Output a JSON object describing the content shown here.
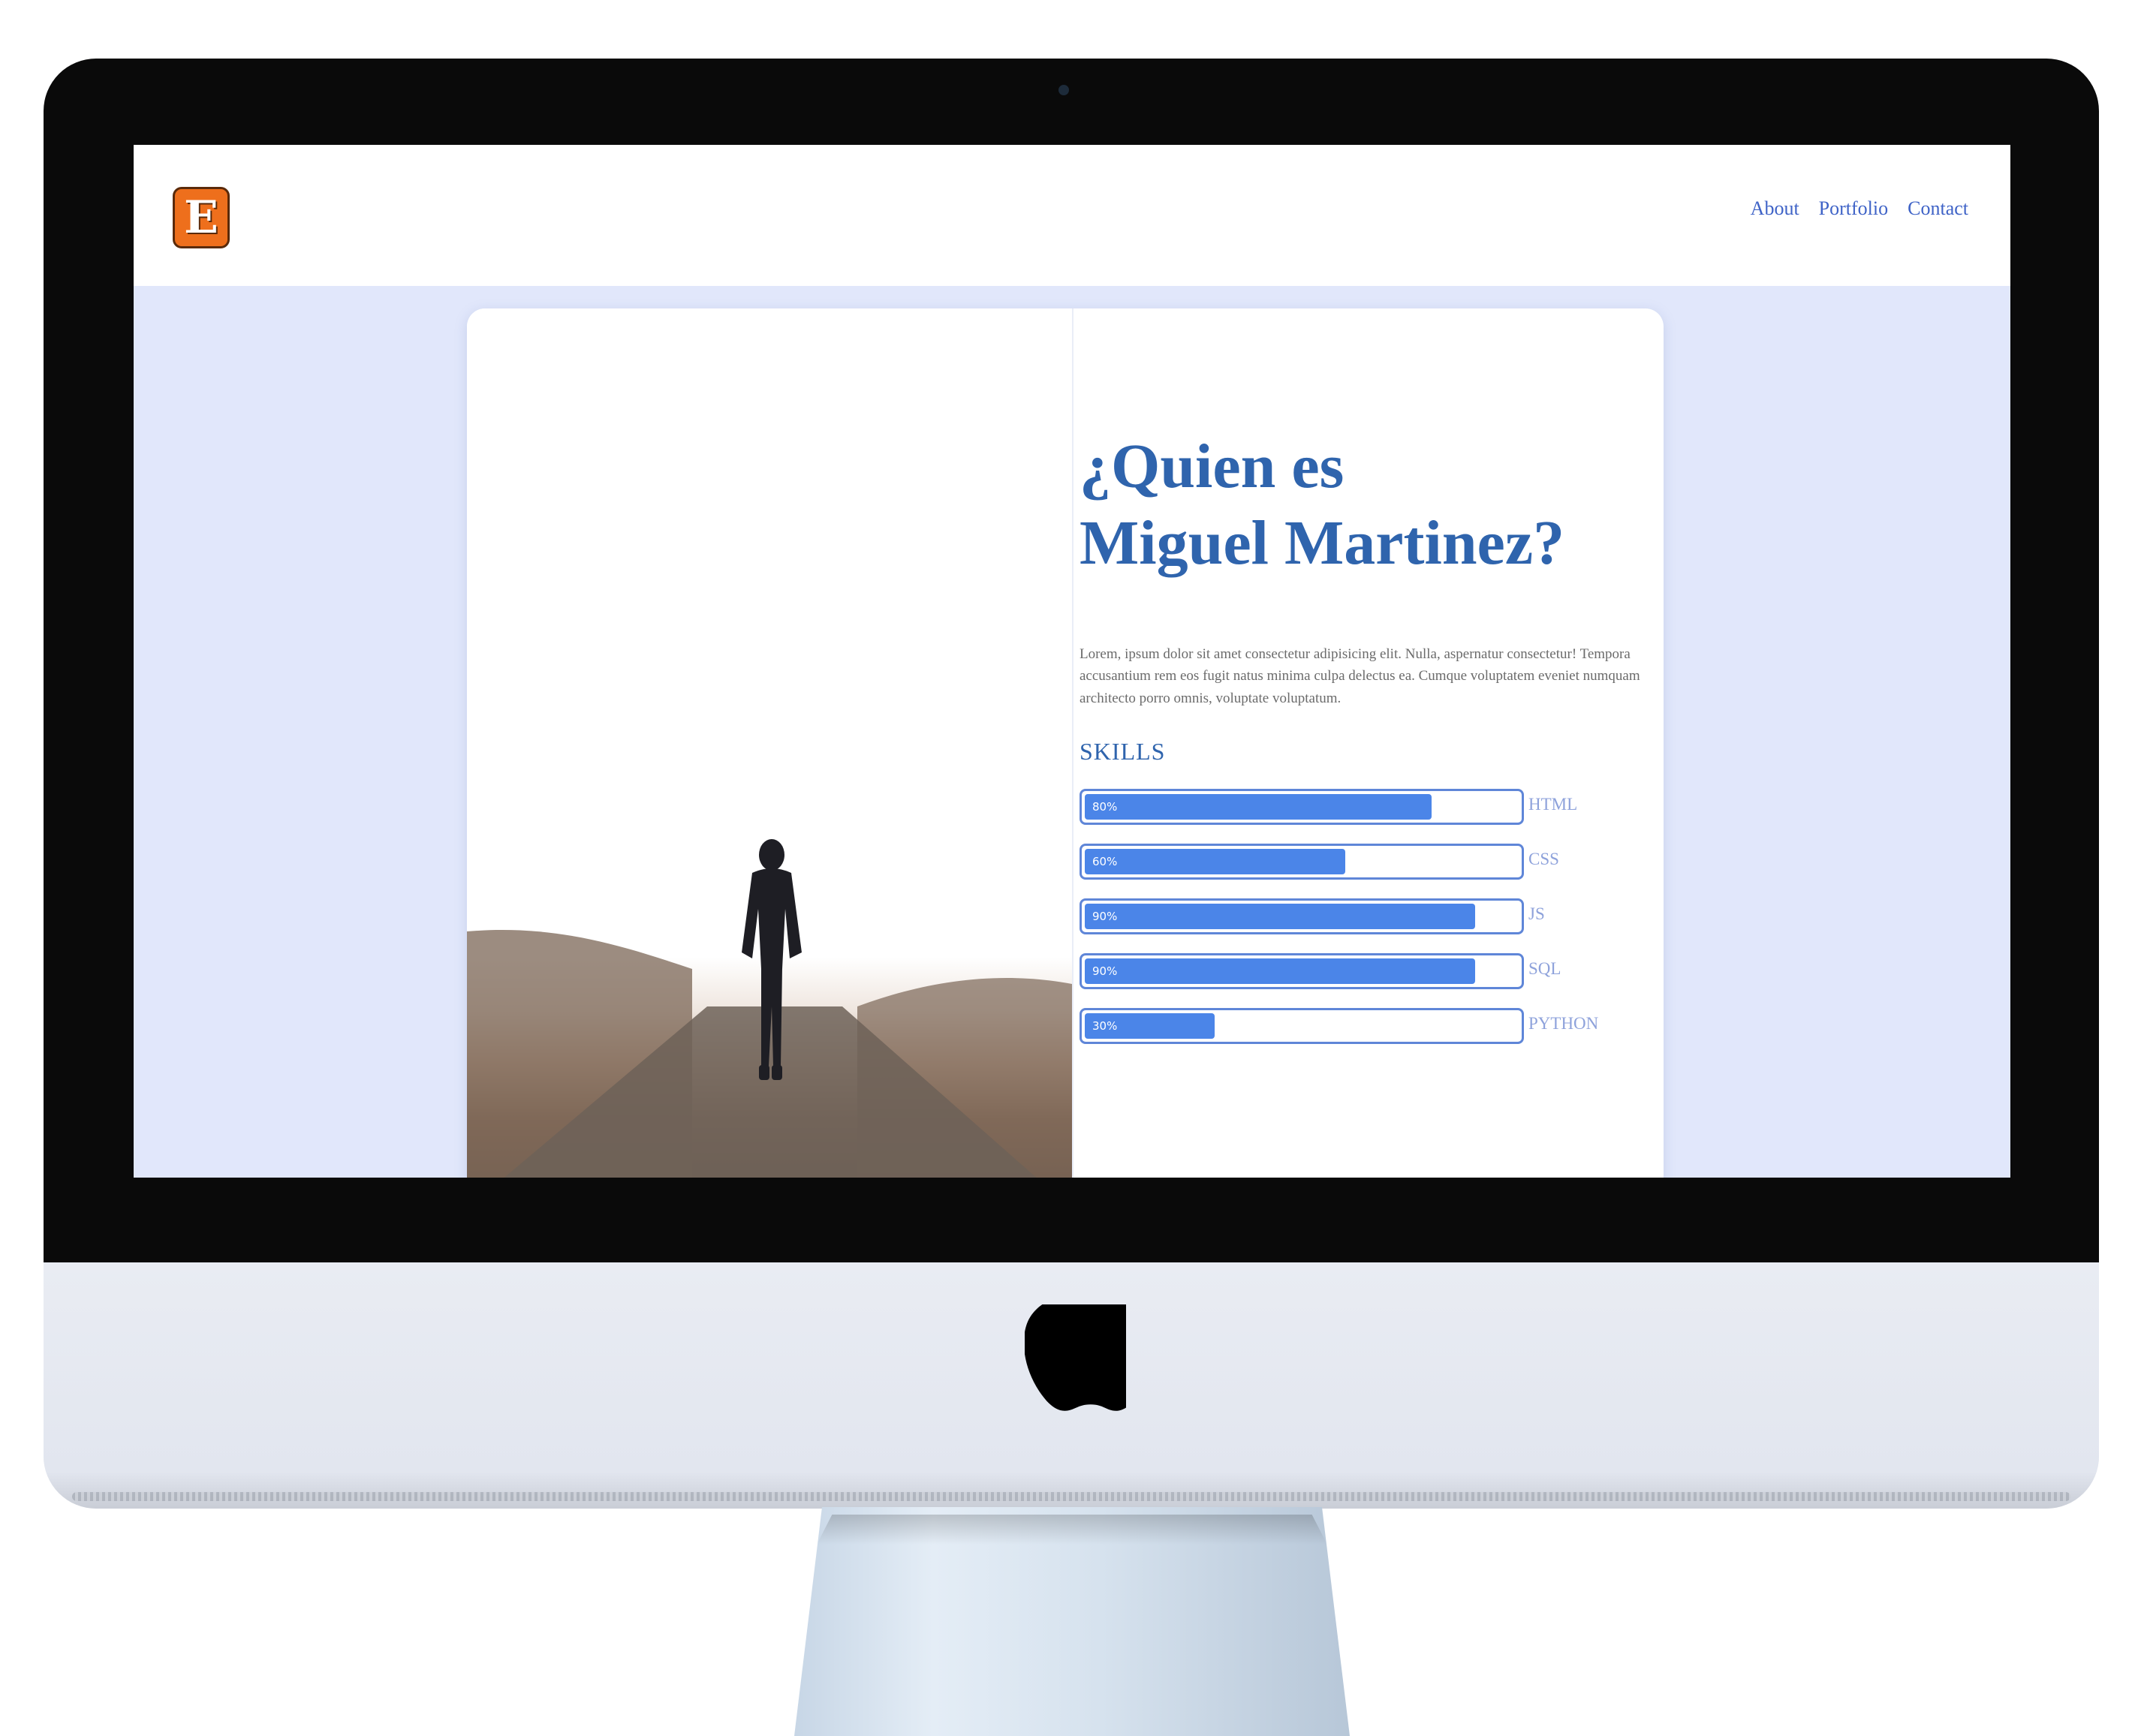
{
  "site": {
    "logo_letter": "E",
    "nav": [
      "About",
      "Portfolio",
      "Contact"
    ]
  },
  "about": {
    "title_line1": "¿Quien es",
    "title_line2": "Miguel Martinez?",
    "description": "Lorem, ipsum dolor sit amet consectetur adipisicing elit. Nulla, aspernatur consectetur! Tempora accusantium rem eos fugit natus minima culpa delectus ea. Cumque voluptatem eveniet numquam architecto porro omnis, voluptate voluptatum.",
    "skills_heading": "SKILLS",
    "skills": [
      {
        "name": "HTML",
        "percent": 80,
        "label": "80%"
      },
      {
        "name": "CSS",
        "percent": 60,
        "label": "60%"
      },
      {
        "name": "JS",
        "percent": 90,
        "label": "90%"
      },
      {
        "name": "SQL",
        "percent": 90,
        "label": "90%"
      },
      {
        "name": "PYTHON",
        "percent": 30,
        "label": "30%"
      }
    ]
  },
  "colors": {
    "accent": "#2f64ad",
    "nav_link": "#3f63c7",
    "skill_fill": "#4b85e8",
    "page_bg": "#e1e7fb",
    "logo_bg": "#ee6f1c"
  },
  "icons": {
    "logo": "letter-e-logo-icon",
    "hardware": "apple-logo-icon"
  }
}
